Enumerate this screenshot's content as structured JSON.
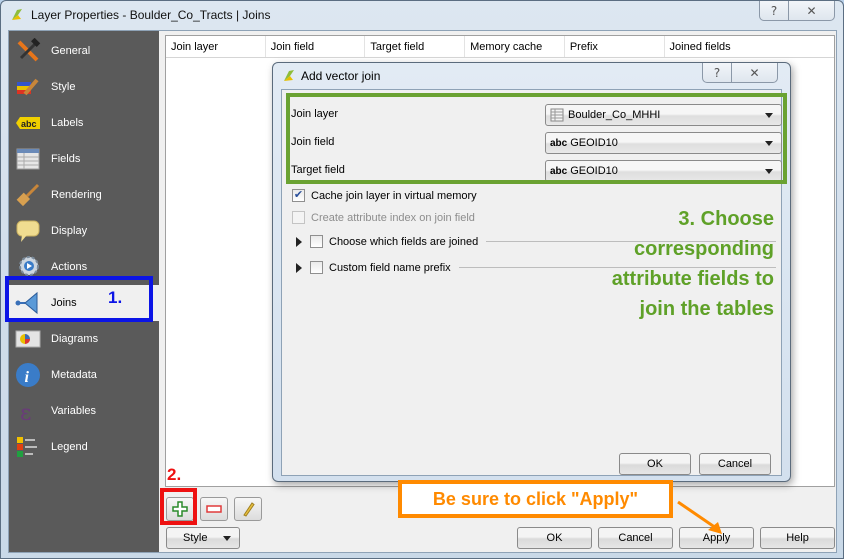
{
  "window": {
    "title": "Layer Properties - Boulder_Co_Tracts | Joins",
    "help_button": "?",
    "close_button": "✕"
  },
  "sidebar": {
    "items": [
      {
        "label": "General",
        "icon": "hammer-wrench-icon"
      },
      {
        "label": "Style",
        "icon": "paintbrush-style-icon"
      },
      {
        "label": "Labels",
        "icon": "abc-label-icon"
      },
      {
        "label": "Fields",
        "icon": "table-fields-icon"
      },
      {
        "label": "Rendering",
        "icon": "brush-icon"
      },
      {
        "label": "Display",
        "icon": "speech-bubble-icon"
      },
      {
        "label": "Actions",
        "icon": "gear-play-icon"
      },
      {
        "label": "Joins",
        "icon": "join-arrow-icon",
        "active": true
      },
      {
        "label": "Diagrams",
        "icon": "diagram-icon"
      },
      {
        "label": "Metadata",
        "icon": "info-icon"
      },
      {
        "label": "Variables",
        "icon": "epsilon-icon"
      },
      {
        "label": "Legend",
        "icon": "legend-icon"
      }
    ]
  },
  "joins_table": {
    "columns": [
      "Join layer",
      "Join field",
      "Target field",
      "Memory cache",
      "Prefix",
      "Joined fields"
    ],
    "rows": []
  },
  "bottom_bar": {
    "style_menu": "Style",
    "ok": "OK",
    "cancel": "Cancel",
    "apply": "Apply",
    "help": "Help"
  },
  "dialog": {
    "title": "Add vector join",
    "help_button": "?",
    "close_button": "✕",
    "join_layer_label": "Join layer",
    "join_layer_value": "Boulder_Co_MHHI",
    "join_field_label": "Join field",
    "join_field_value": "GEOID10",
    "target_field_label": "Target field",
    "target_field_value": "GEOID10",
    "field_type_badge": "abc",
    "cache_label": "Cache join layer in virtual memory",
    "cache_checked": true,
    "index_label": "Create attribute index on join field",
    "index_checked": false,
    "choose_fields_label": "Choose which fields are joined",
    "choose_fields_checked": false,
    "prefix_label": "Custom field name prefix",
    "prefix_checked": false,
    "ok": "OK",
    "cancel": "Cancel"
  },
  "annotations": {
    "step1": "1.",
    "step2": "2.",
    "step3_lines": [
      "3. Choose",
      "corresponding",
      "attribute fields to",
      "join the tables"
    ],
    "apply_note": "Be sure to click \"Apply\"",
    "colors": {
      "step1": "#0b14e6",
      "step2": "#ee1111",
      "step3": "#5fa128",
      "apply_note": "#ff8a00"
    }
  }
}
